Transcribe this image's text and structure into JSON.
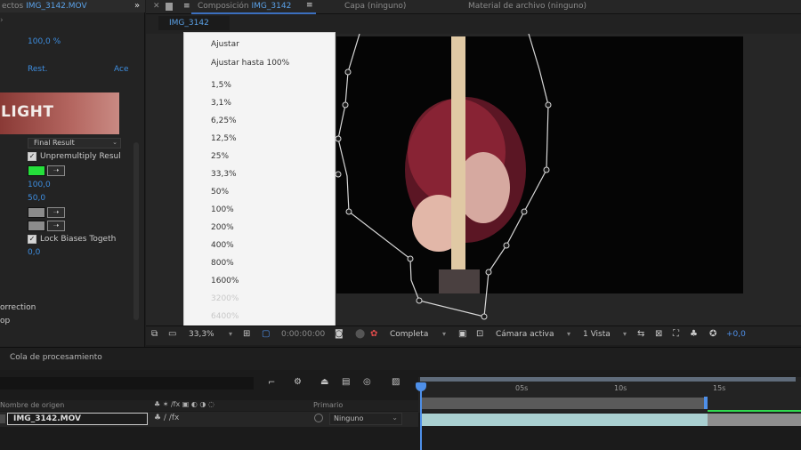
{
  "effects_panel": {
    "tab_label": "ectos",
    "tab_file": "IMG_3142.MOV",
    "close_symbol": "»",
    "percent_value": "100,0 %",
    "reset_label": "Rest.",
    "about_label": "Ace",
    "banner_text": "LIGHT",
    "mode_dropdown": "Final Result",
    "unpremultiply_label": "Unpremultiply Resul",
    "value_100": "100,0",
    "value_50": "50,0",
    "lock_biases_label": "Lock Biases Togeth",
    "value_0": "0,0",
    "correction_label": "orrection",
    "other_label": "op",
    "colors": {
      "swatch_green": "#25e03b",
      "swatch_grey": "#8b8b8b"
    }
  },
  "comp_header": {
    "composition_label": "Composición",
    "composition_name": "IMG_3142",
    "layer_label": "Capa (ninguno)",
    "footage_label": "Material de archivo (ninguno)",
    "subtab_label": "IMG_3142"
  },
  "zoom_menu": {
    "items": [
      {
        "label": "Ajustar",
        "enabled": true
      },
      {
        "label": "Ajustar hasta 100%",
        "enabled": true
      },
      {
        "label": "1,5%",
        "enabled": true
      },
      {
        "label": "3,1%",
        "enabled": true
      },
      {
        "label": "6,25%",
        "enabled": true
      },
      {
        "label": "12,5%",
        "enabled": true
      },
      {
        "label": "25%",
        "enabled": true
      },
      {
        "label": "33,3%",
        "enabled": true
      },
      {
        "label": "50%",
        "enabled": true
      },
      {
        "label": "100%",
        "enabled": true
      },
      {
        "label": "200%",
        "enabled": true
      },
      {
        "label": "400%",
        "enabled": true
      },
      {
        "label": "800%",
        "enabled": true
      },
      {
        "label": "1600%",
        "enabled": true
      },
      {
        "label": "3200%",
        "enabled": false
      },
      {
        "label": "6400%",
        "enabled": false
      }
    ]
  },
  "viewer_toolbar": {
    "zoom_value": "33,3%",
    "timecode": "0:00:00:00",
    "resolution": "Completa",
    "camera": "Cámara activa",
    "views": "1 Vista",
    "exposure": "+0,0"
  },
  "render_queue": {
    "label": "Cola de procesamiento"
  },
  "timeline": {
    "source_name_header": "Nombre de origen",
    "parent_header": "Primario",
    "layer_name": "IMG_3142.MOV",
    "parent_value": "Ninguno",
    "ticks": [
      "05s",
      "10s",
      "15s"
    ]
  }
}
